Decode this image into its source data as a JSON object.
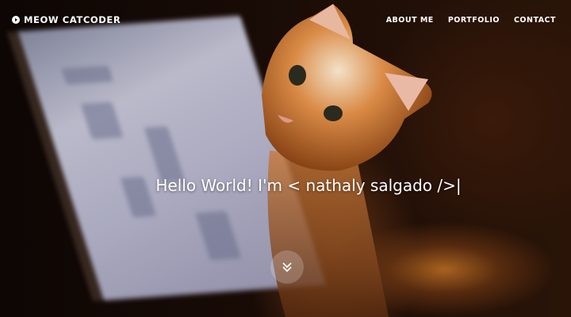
{
  "nav": {
    "brand": "MEOW CATCODER",
    "brand_icon": "play-circle-icon",
    "links": [
      "ABOUT ME",
      "PORTFOLIO",
      "CONTACT"
    ]
  },
  "hero": {
    "headline": "Hello World! I'm < nathaly salgado />|",
    "scroll_icon": "double-chevron-down-icon"
  }
}
